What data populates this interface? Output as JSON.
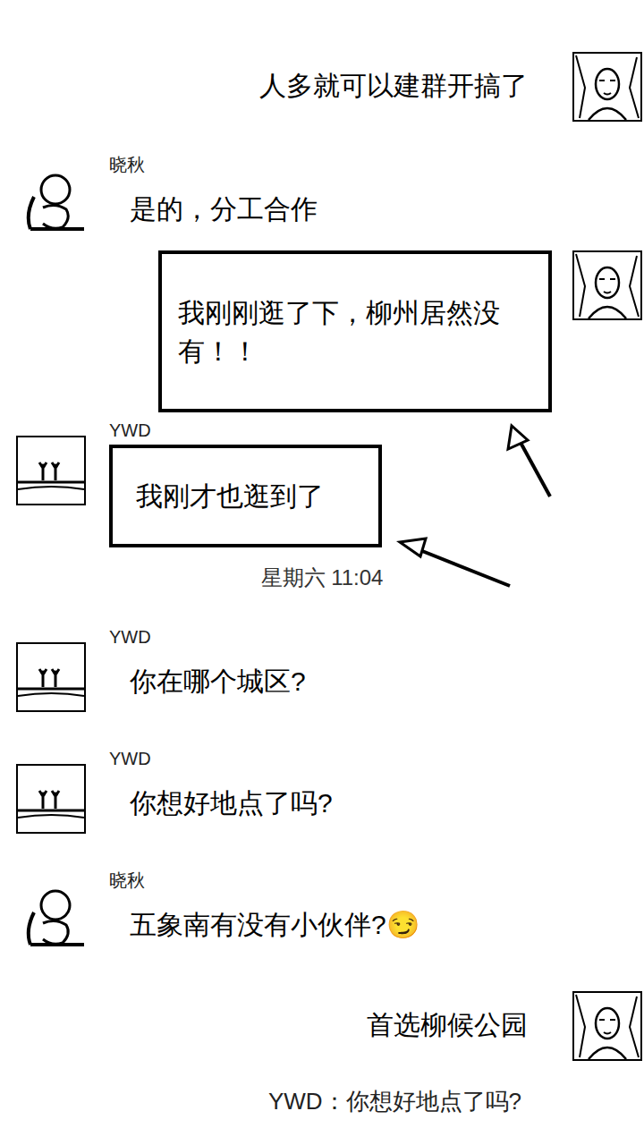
{
  "chat": {
    "messages": [
      {
        "kind": "message",
        "side": "right",
        "sender": "",
        "text": "人多就可以建群开搞了",
        "highlighted": false
      },
      {
        "kind": "message",
        "side": "left",
        "sender": "晓秋",
        "text": "是的，分工合作",
        "highlighted": false
      },
      {
        "kind": "message",
        "side": "right",
        "sender": "",
        "text": "我刚刚逛了下，柳州居然没有！！",
        "highlighted": true
      },
      {
        "kind": "message",
        "side": "left",
        "sender": "YWD",
        "text": "我刚才也逛到了",
        "highlighted": true
      },
      {
        "kind": "time",
        "side": "center",
        "sender": "",
        "text": "星期六 11:04",
        "highlighted": false
      },
      {
        "kind": "message",
        "side": "left",
        "sender": "YWD",
        "text": "你在哪个城区?",
        "highlighted": false
      },
      {
        "kind": "message",
        "side": "left",
        "sender": "YWD",
        "text": "你想好地点了吗?",
        "highlighted": false
      },
      {
        "kind": "message",
        "side": "left",
        "sender": "晓秋",
        "text": "五象南有没有小伙伴?😏",
        "highlighted": false
      },
      {
        "kind": "message",
        "side": "right",
        "sender": "",
        "text": "首选柳候公园",
        "highlighted": false
      }
    ],
    "quote": {
      "text": "YWD：你想好地点了吗?"
    }
  }
}
